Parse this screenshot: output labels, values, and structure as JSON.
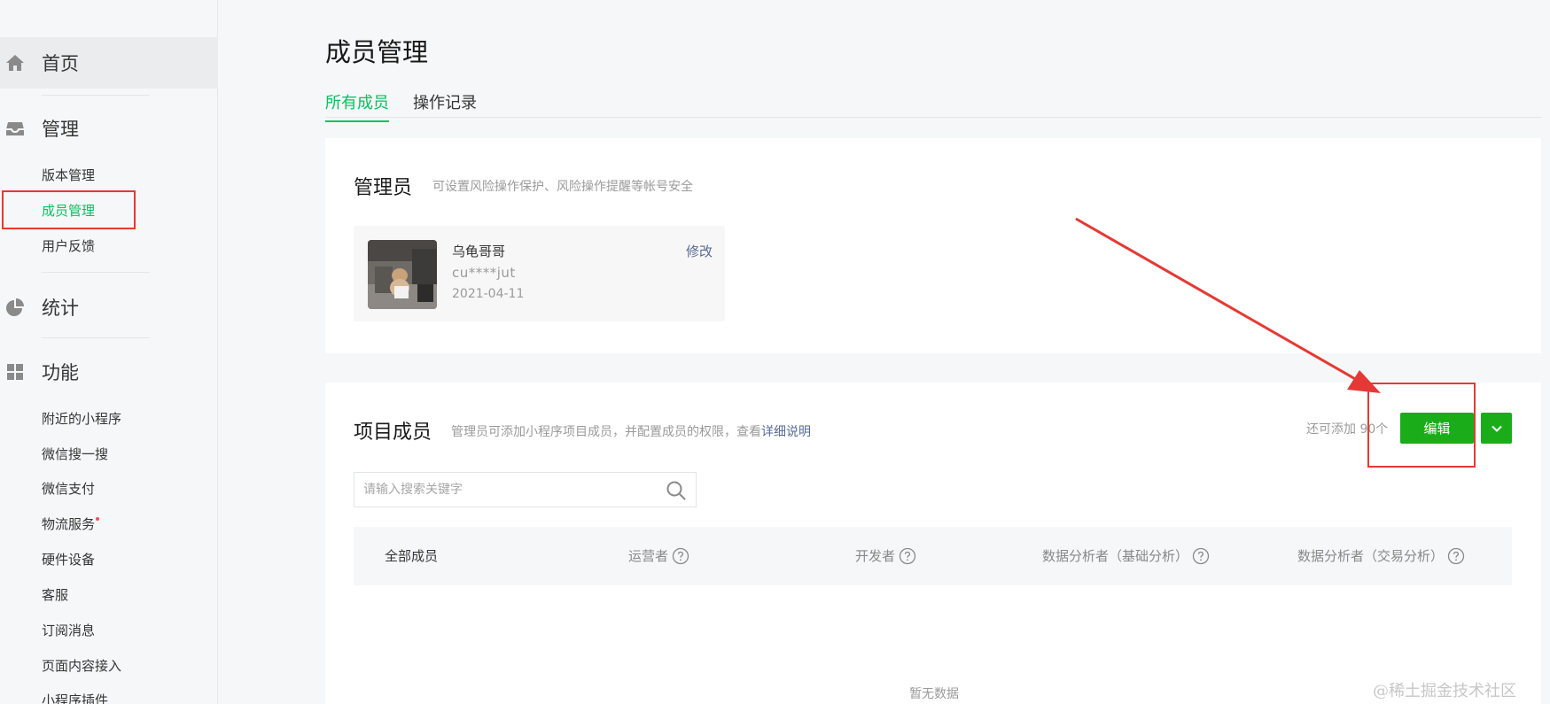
{
  "sidebar": {
    "home": {
      "label": "首页"
    },
    "manage": {
      "label": "管理",
      "items": [
        {
          "label": "版本管理"
        },
        {
          "label": "成员管理",
          "active": true
        },
        {
          "label": "用户反馈"
        }
      ]
    },
    "stats": {
      "label": "统计"
    },
    "functions": {
      "label": "功能",
      "items": [
        {
          "label": "附近的小程序"
        },
        {
          "label": "微信搜一搜"
        },
        {
          "label": "微信支付"
        },
        {
          "label": "物流服务",
          "badge_dot": true
        },
        {
          "label": "硬件设备"
        },
        {
          "label": "客服"
        },
        {
          "label": "订阅消息"
        },
        {
          "label": "页面内容接入"
        },
        {
          "label": "小程序插件"
        }
      ]
    }
  },
  "page": {
    "title": "成员管理",
    "tabs": [
      {
        "label": "所有成员",
        "active": true
      },
      {
        "label": "操作记录"
      }
    ]
  },
  "admin_section": {
    "title": "管理员",
    "description": "可设置风险操作保护、风险操作提醒等帐号安全",
    "admin": {
      "name": "乌龟哥哥",
      "account": "cu****jut",
      "date": "2021-04-11",
      "edit_label": "修改"
    }
  },
  "members_section": {
    "title": "项目成员",
    "description": "管理员可添加小程序项目成员，并配置成员的权限，查看",
    "description_link": "详细说明",
    "quota_text": "还可添加 90个",
    "edit_button": "编辑",
    "search": {
      "placeholder": "请输入搜索关键字"
    },
    "columns": [
      {
        "label": "全部成员"
      },
      {
        "label": "运营者"
      },
      {
        "label": "开发者"
      },
      {
        "label": "数据分析者（基础分析）"
      },
      {
        "label": "数据分析者（交易分析）"
      }
    ],
    "empty_text": "暂无数据"
  },
  "colors": {
    "accent_green": "#07c160",
    "button_green": "#1aad19",
    "link_blue": "#576b95",
    "annotation_red": "#e53935"
  },
  "icons": {
    "home": "home-icon",
    "manage": "inbox-icon",
    "stats": "pie-chart-icon",
    "functions": "grid-icon",
    "search": "search-icon",
    "help": "question-circle-icon",
    "dropdown": "chevron-down-icon"
  },
  "watermark": "@稀土掘金技术社区"
}
